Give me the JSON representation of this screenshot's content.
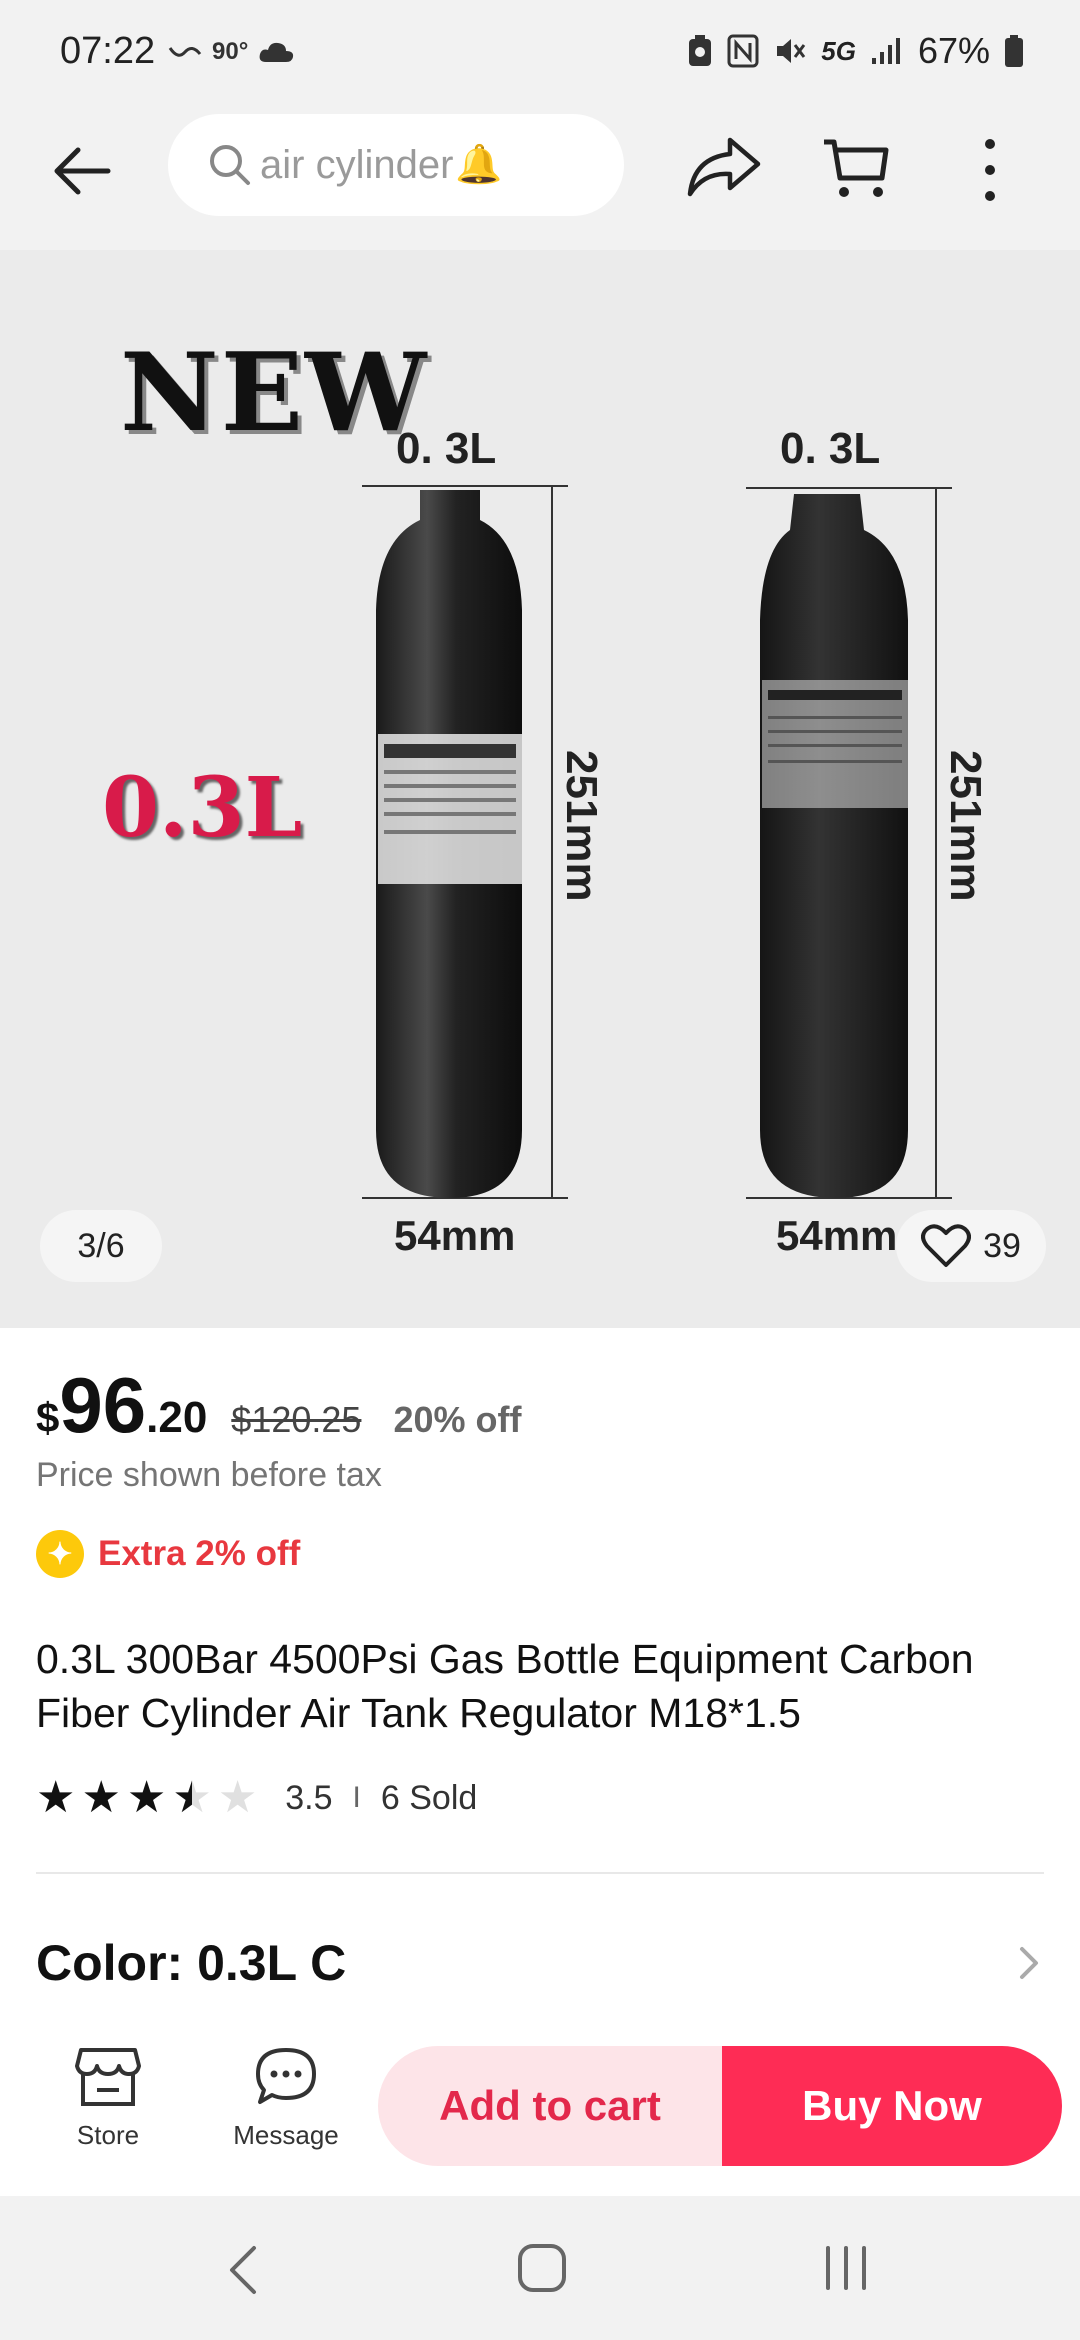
{
  "status_bar": {
    "time": "07:22",
    "temperature": "90°",
    "network": "5G",
    "battery": "67%"
  },
  "top_bar": {
    "search_text": "air cylinder",
    "search_emoji": "🔔",
    "icons": [
      "back-arrow-icon",
      "search-icon",
      "share-icon",
      "cart-icon",
      "more-icon"
    ]
  },
  "gallery": {
    "new_text": "NEW",
    "volume_text": "0.3L",
    "left_capacity": "0. 3L",
    "right_capacity": "0. 3L",
    "left_height": "251mm",
    "right_height": "251mm",
    "left_diameter": "54mm",
    "right_diameter": "54mm",
    "counter": "3/6",
    "favorites": "39"
  },
  "price": {
    "currency": "$",
    "integer": "96",
    "decimal": ".20",
    "original": "$120.25",
    "discount": "20% off",
    "tax_note": "Price shown before tax",
    "extra_off": "Extra 2% off"
  },
  "product": {
    "title": "0.3L 300Bar 4500Psi Gas Bottle Equipment Carbon Fiber Cylinder Air Tank   Regulator M18*1.5",
    "rating": 3.5,
    "rating_text": "3.5",
    "separator": "I",
    "sold": "6 Sold",
    "color_label": "Color: 0.3L C"
  },
  "actions": {
    "store": "Store",
    "message": "Message",
    "add_to_cart": "Add to cart",
    "buy_now": "Buy Now"
  },
  "colors": {
    "accent": "#fe2c55",
    "add_cart_bg": "#fde4e8",
    "discount_red": "#e8383f",
    "coin_yellow": "#fdc90b"
  }
}
